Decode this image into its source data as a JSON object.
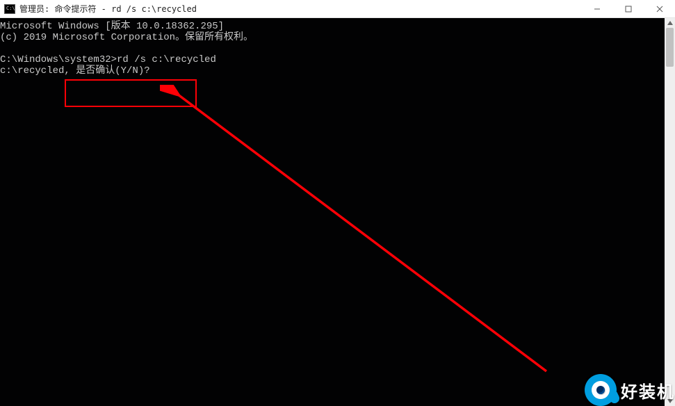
{
  "titlebar": {
    "title": "管理员: 命令提示符 - rd  /s c:\\recycled"
  },
  "console": {
    "lines": [
      "Microsoft Windows [版本 10.0.18362.295]",
      "(c) 2019 Microsoft Corporation。保留所有权利。",
      "",
      "C:\\Windows\\system32>rd /s c:\\recycled",
      "c:\\recycled, 是否确认(Y/N)?"
    ]
  },
  "annotation": {
    "highlight_text": "是否确认(Y/N)?"
  },
  "watermark": {
    "text": "好装机"
  }
}
